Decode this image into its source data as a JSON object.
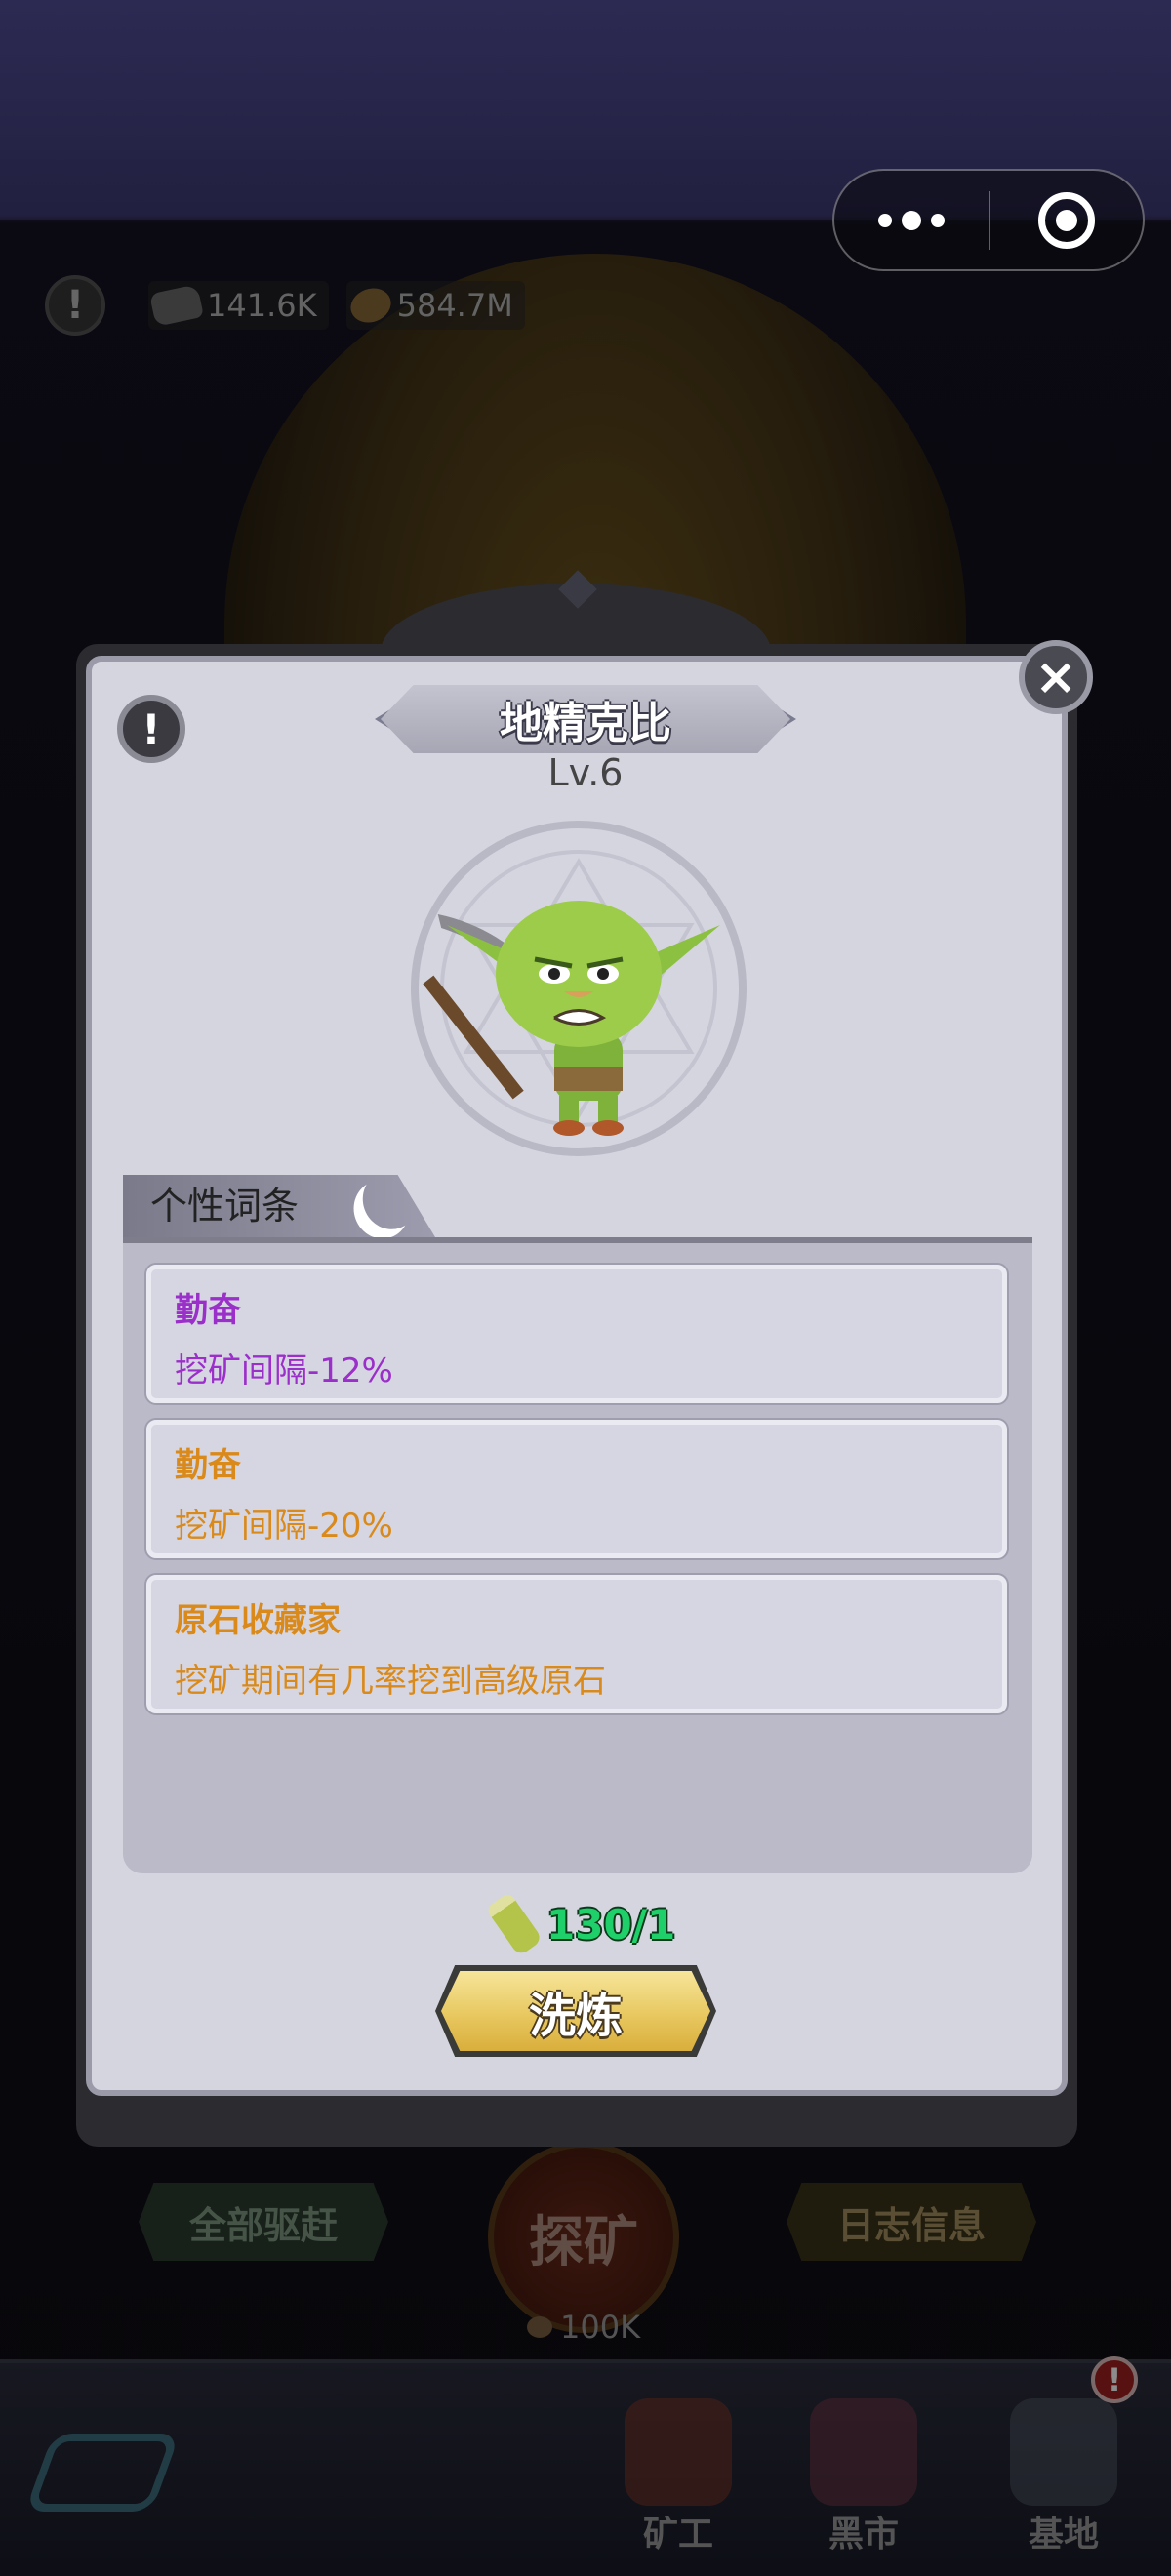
{
  "hud": {
    "ore_amount": "141.6K",
    "coin_amount": "584.7M"
  },
  "modal": {
    "title": "地精克比",
    "level": "Lv.6",
    "traits_title": "个性词条",
    "traits": [
      {
        "name": "勤奋",
        "desc": "挖矿间隔-12%",
        "color": "#9b2fc9"
      },
      {
        "name": "勤奋",
        "desc": "挖矿间隔-20%",
        "color": "#d98a1a"
      },
      {
        "name": "原石收藏家",
        "desc": "挖矿期间有几率挖到高级原石",
        "color": "#d98a1a"
      }
    ],
    "refine_cost": "130/1",
    "refine_label": "洗炼"
  },
  "controls": {
    "expel_all_label": "全部驱赶",
    "explore_label": "探矿",
    "explore_cost": "100K",
    "log_label": "日志信息"
  },
  "nav": {
    "items": [
      {
        "label": "矿工"
      },
      {
        "label": "黑市"
      },
      {
        "label": "基地"
      }
    ]
  },
  "colors": {
    "cost_green": "#1fd06a",
    "button_gold": "#e8c860"
  }
}
